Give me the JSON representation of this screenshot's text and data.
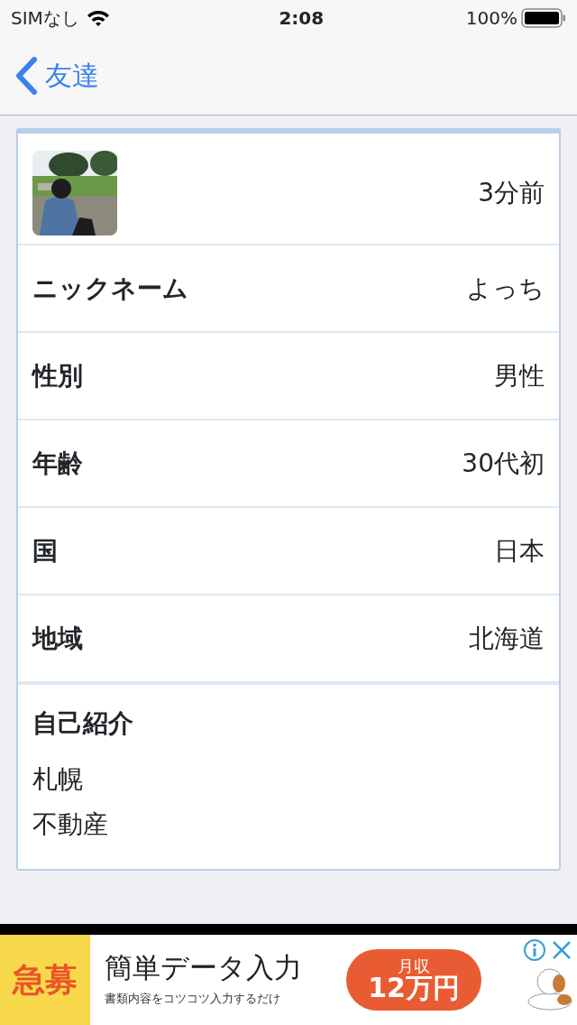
{
  "status_bar": {
    "carrier": "SIMなし",
    "time": "2:08",
    "battery": "100%"
  },
  "nav": {
    "back_label": "友達"
  },
  "profile": {
    "last_seen": "3分前",
    "rows": [
      {
        "label": "ニックネーム",
        "value": "よっち"
      },
      {
        "label": "性別",
        "value": "男性"
      },
      {
        "label": "年齢",
        "value": "30代初"
      },
      {
        "label": "国",
        "value": "日本"
      },
      {
        "label": "地域",
        "value": "北海道"
      }
    ],
    "intro": {
      "label": "自己紹介",
      "lines": [
        "札幌",
        "不動産"
      ]
    }
  },
  "ad": {
    "tag": "急募",
    "headline": "簡単データ入力",
    "subline": "書類内容をコツコツ入力するだけ",
    "pay_label": "月収",
    "pay_amount": "12万円"
  }
}
